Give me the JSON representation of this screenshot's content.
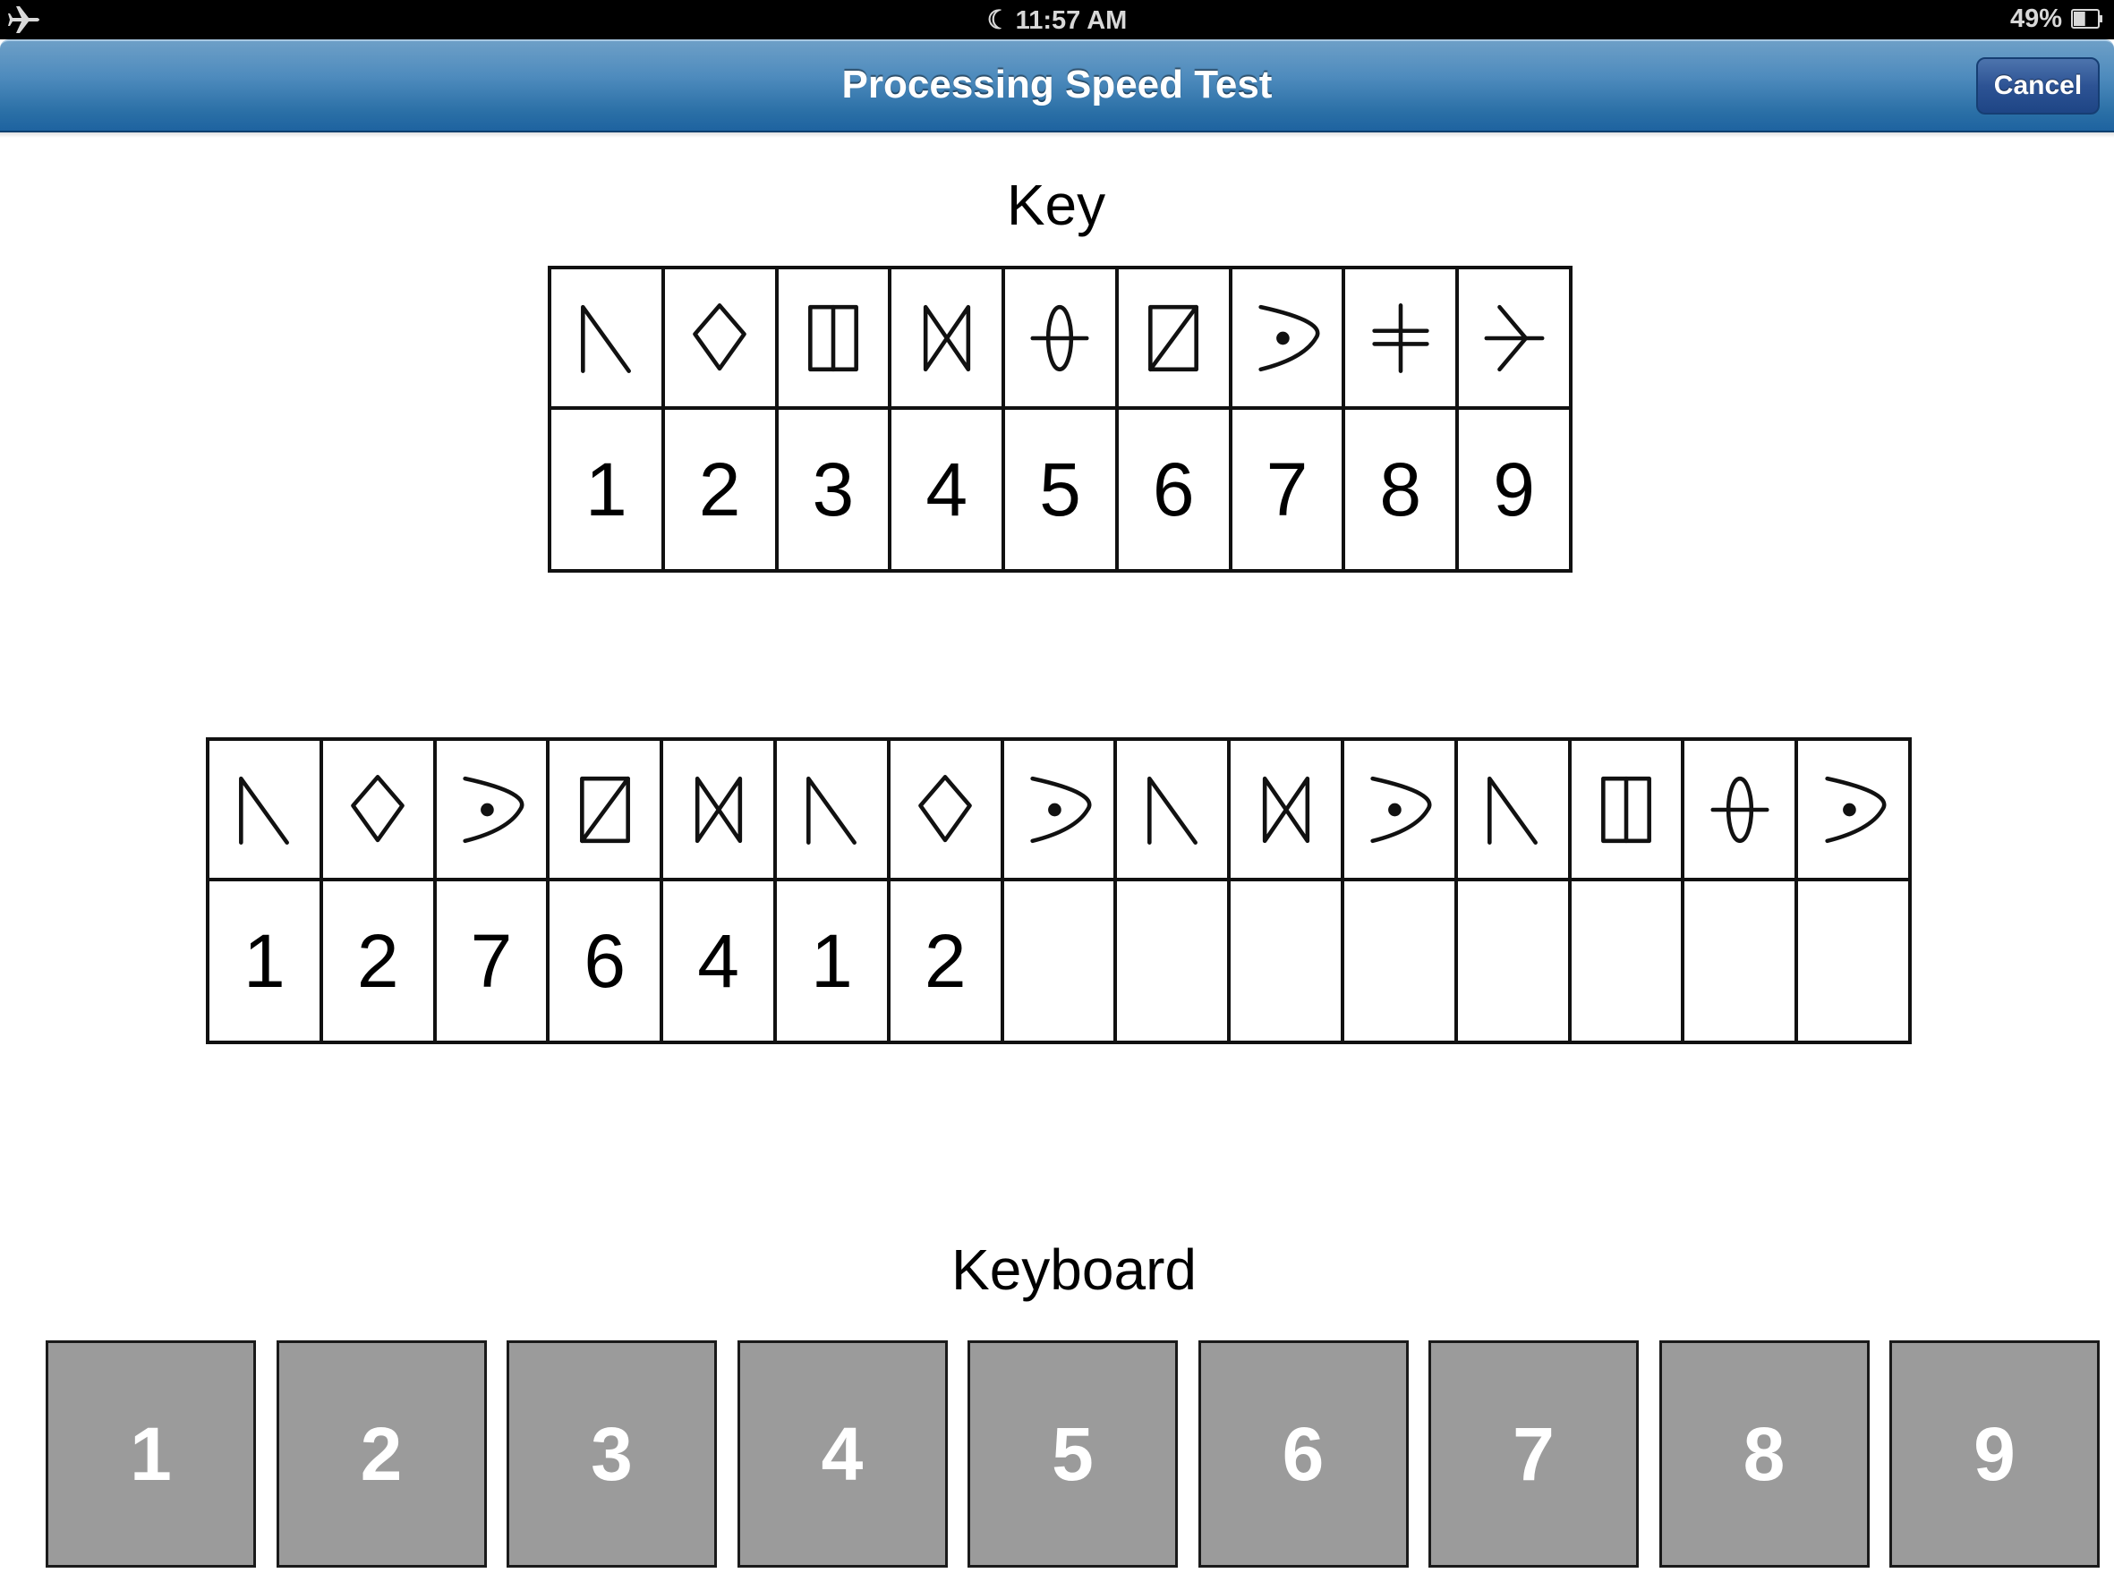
{
  "status_bar": {
    "airplane_icon": "airplane-icon",
    "moon_icon": "moon-icon",
    "time": "11:57 AM",
    "battery_percent": "49%",
    "battery_level": 0.49,
    "battery_icon": "battery-icon"
  },
  "nav_bar": {
    "title": "Processing Speed Test",
    "cancel_label": "Cancel"
  },
  "key": {
    "label": "Key",
    "columns": [
      {
        "symbol": "n-shape",
        "number": "1"
      },
      {
        "symbol": "diamond",
        "number": "2"
      },
      {
        "symbol": "split-box",
        "number": "3"
      },
      {
        "symbol": "bowtie",
        "number": "4"
      },
      {
        "symbol": "ellipse-bar",
        "number": "5"
      },
      {
        "symbol": "slash-box",
        "number": "6"
      },
      {
        "symbol": "arc-dot",
        "number": "7"
      },
      {
        "symbol": "double-cross",
        "number": "8"
      },
      {
        "symbol": "arrow",
        "number": "9"
      }
    ]
  },
  "test": {
    "items": [
      {
        "symbol": "n-shape",
        "answer": "1"
      },
      {
        "symbol": "diamond",
        "answer": "2"
      },
      {
        "symbol": "arc-dot",
        "answer": "7"
      },
      {
        "symbol": "slash-box",
        "answer": "6"
      },
      {
        "symbol": "bowtie",
        "answer": "4"
      },
      {
        "symbol": "n-shape",
        "answer": "1"
      },
      {
        "symbol": "diamond",
        "answer": "2"
      },
      {
        "symbol": "arc-dot",
        "answer": ""
      },
      {
        "symbol": "n-shape",
        "answer": ""
      },
      {
        "symbol": "bowtie",
        "answer": ""
      },
      {
        "symbol": "arc-dot",
        "answer": ""
      },
      {
        "symbol": "n-shape",
        "answer": ""
      },
      {
        "symbol": "split-box",
        "answer": ""
      },
      {
        "symbol": "ellipse-bar",
        "answer": ""
      },
      {
        "symbol": "arc-dot",
        "answer": ""
      }
    ]
  },
  "keyboard": {
    "label": "Keyboard",
    "keys": [
      "1",
      "2",
      "3",
      "4",
      "5",
      "6",
      "7",
      "8",
      "9"
    ]
  },
  "colors": {
    "nav_blue": "#2a6fa6",
    "cancel_blue": "#2d5394",
    "key_gray": "#9b9b9b"
  }
}
